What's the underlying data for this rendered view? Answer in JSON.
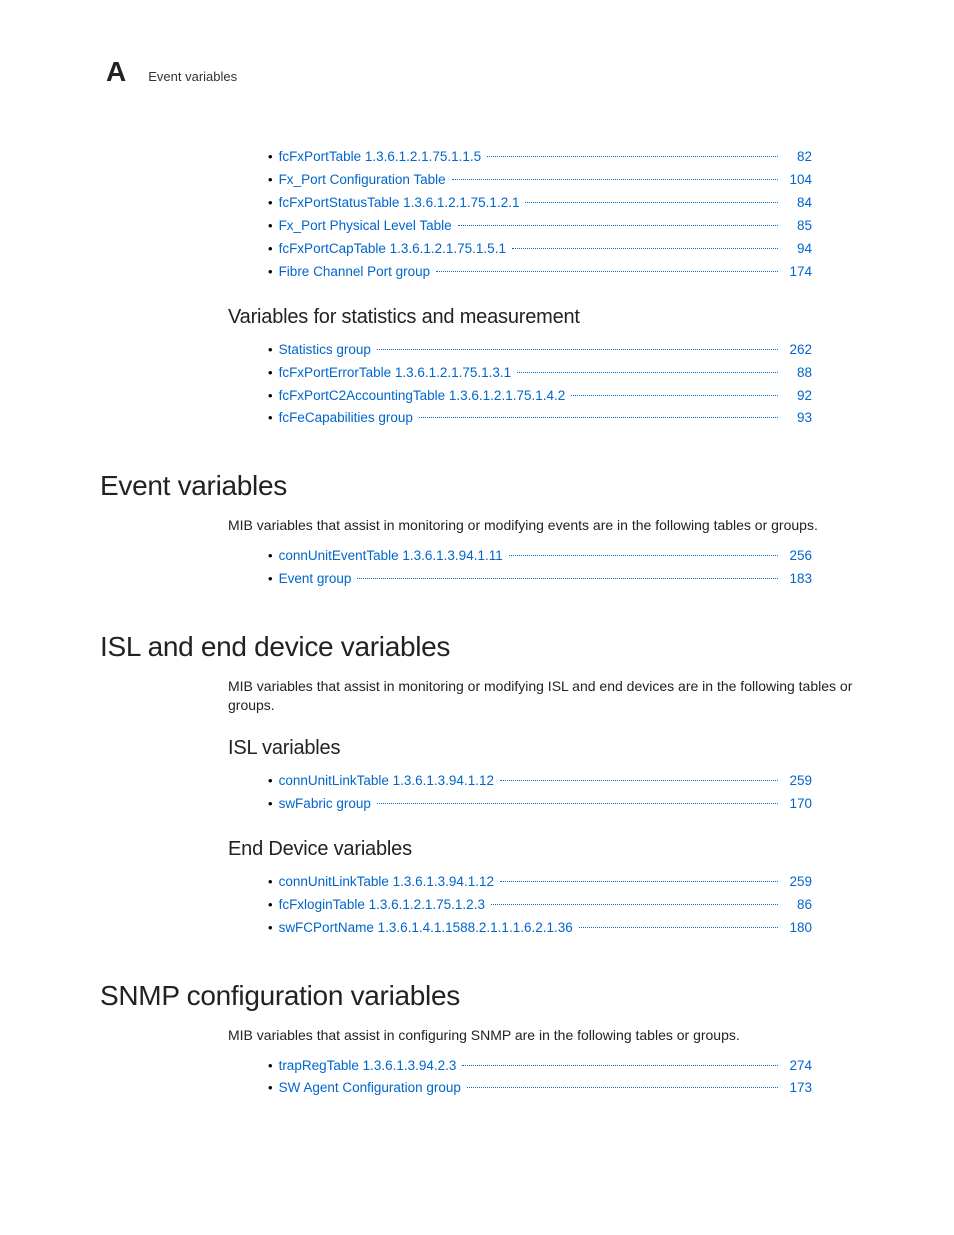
{
  "header": {
    "section_letter": "A",
    "breadcrumb": "Event variables"
  },
  "top_list": [
    {
      "label": "fcFxPortTable 1.3.6.1.2.1.75.1.1.5",
      "page": "82"
    },
    {
      "label": "Fx_Port Configuration Table",
      "page": "104"
    },
    {
      "label": "fcFxPortStatusTable 1.3.6.1.2.1.75.1.2.1",
      "page": "84"
    },
    {
      "label": "Fx_Port Physical Level Table",
      "page": "85"
    },
    {
      "label": "fcFxPortCapTable 1.3.6.1.2.1.75.1.5.1",
      "page": "94"
    },
    {
      "label": "Fibre Channel Port group",
      "page": "174"
    }
  ],
  "stats_heading": "Variables for statistics and measurement",
  "stats_list": [
    {
      "label": "Statistics group",
      "page": "262"
    },
    {
      "label": "fcFxPortErrorTable 1.3.6.1.2.1.75.1.3.1",
      "page": "88"
    },
    {
      "label": "fcFxPortC2AccountingTable 1.3.6.1.2.1.75.1.4.2",
      "page": "92"
    },
    {
      "label": "fcFeCapabilities group",
      "page": "93"
    }
  ],
  "event": {
    "heading": "Event variables",
    "para": "MIB variables that assist in monitoring or modifying events are in the following tables or groups.",
    "list": [
      {
        "label": "connUnitEventTable 1.3.6.1.3.94.1.11",
        "page": "256"
      },
      {
        "label": "Event group",
        "page": "183"
      }
    ]
  },
  "isl": {
    "heading": "ISL and end device variables",
    "para": "MIB variables that assist in monitoring or modifying ISL and end devices are in the following tables or groups.",
    "sub1_heading": "ISL variables",
    "sub1_list": [
      {
        "label": "connUnitLinkTable 1.3.6.1.3.94.1.12",
        "page": "259"
      },
      {
        "label": "swFabric group",
        "page": "170"
      }
    ],
    "sub2_heading": "End Device variables",
    "sub2_list": [
      {
        "label": "connUnitLinkTable 1.3.6.1.3.94.1.12",
        "page": "259"
      },
      {
        "label": "fcFxloginTable 1.3.6.1.2.1.75.1.2.3",
        "page": "86"
      },
      {
        "label": "swFCPortName 1.3.6.1.4.1.1588.2.1.1.1.6.2.1.36",
        "page": "180"
      }
    ]
  },
  "snmp": {
    "heading": "SNMP configuration variables",
    "para": "MIB variables that assist in configuring SNMP are in the following tables or groups.",
    "list": [
      {
        "label": "trapRegTable 1.3.6.1.3.94.2.3",
        "page": "274"
      },
      {
        "label": "SW Agent Configuration group",
        "page": "173"
      }
    ]
  }
}
